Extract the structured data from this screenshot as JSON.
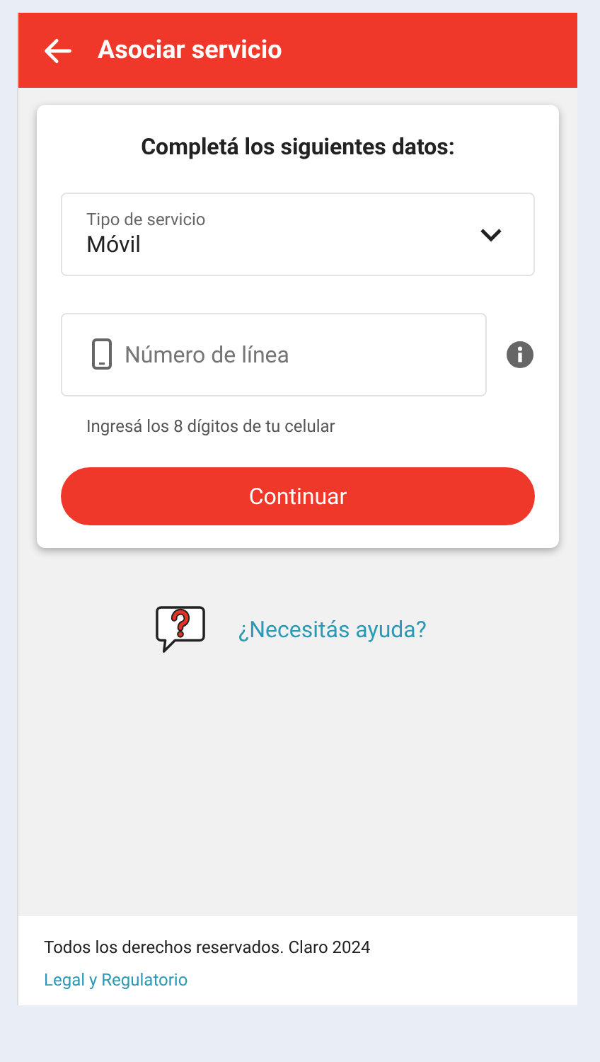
{
  "header": {
    "title": "Asociar servicio"
  },
  "card": {
    "heading": "Completá los siguientes datos:",
    "service_type": {
      "label": "Tipo de servicio",
      "value": "Móvil"
    },
    "line_number": {
      "placeholder": "Número de línea",
      "hint": "Ingresá los 8 dígitos de tu celular"
    },
    "button": "Continuar"
  },
  "help_link": "¿Necesitás ayuda?",
  "footer": {
    "copyright": "Todos los derechos reservados. Claro 2024",
    "link": "Legal y Regulatorio"
  }
}
